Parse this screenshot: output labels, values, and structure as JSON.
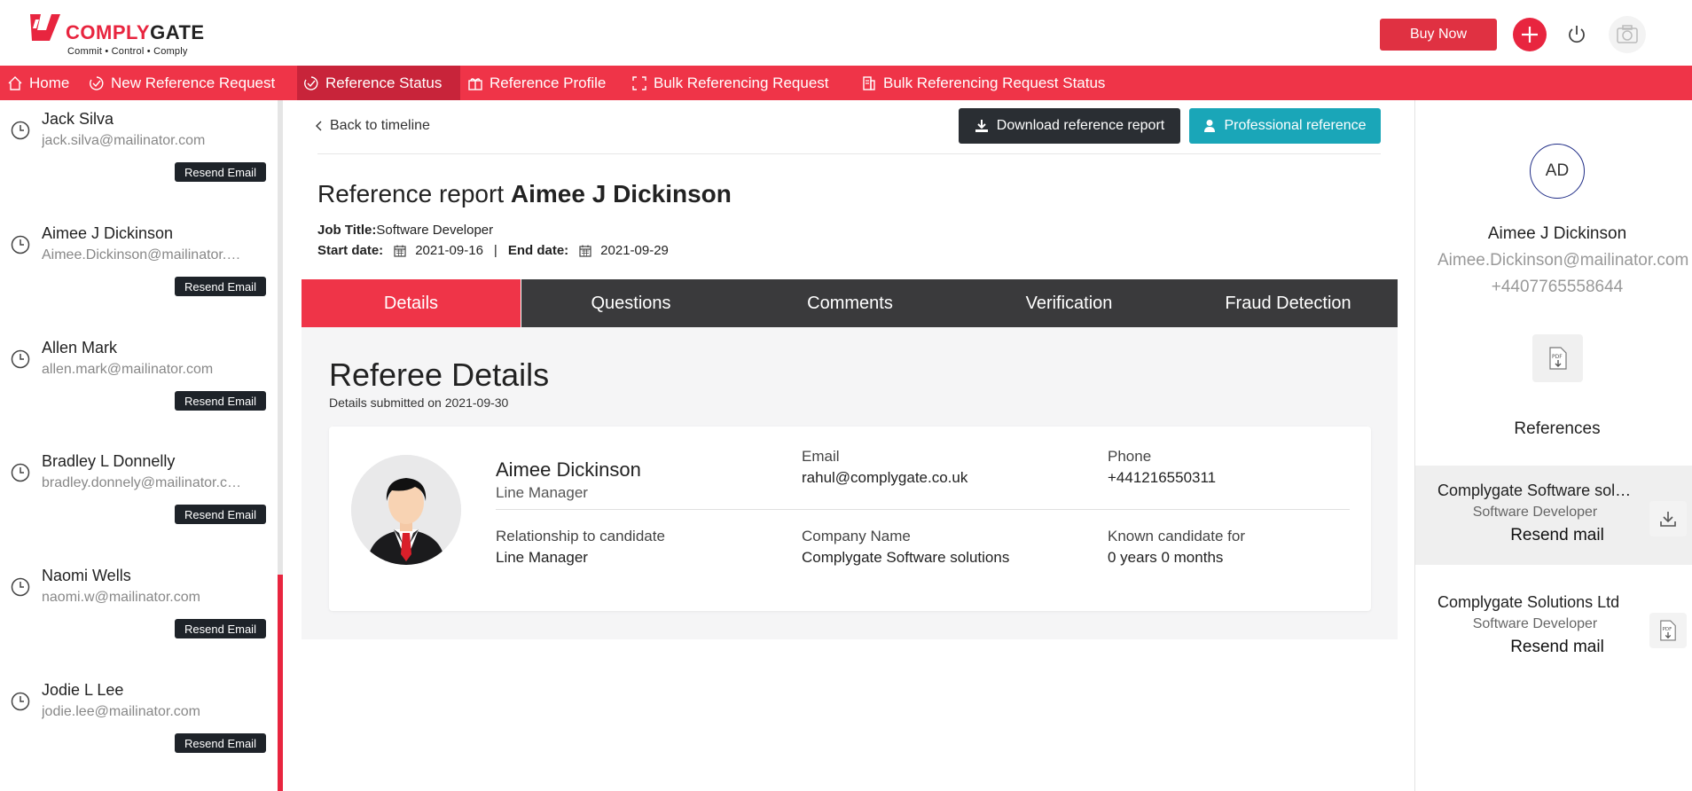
{
  "brand": {
    "name_red": "COMPLY",
    "name_dark": "GATE",
    "tagline": "Commit • Control • Comply",
    "accent_color": "#ef3448"
  },
  "header": {
    "buy_now_label": "Buy Now"
  },
  "nav": {
    "items": [
      {
        "label": "Home",
        "icon": "home-icon"
      },
      {
        "label": "New Reference Request",
        "icon": "request-icon"
      },
      {
        "label": "Reference Status",
        "icon": "status-icon",
        "active": true
      },
      {
        "label": "Reference Profile",
        "icon": "profile-icon"
      },
      {
        "label": "Bulk Referencing Request",
        "icon": "bulk-icon"
      },
      {
        "label": "Bulk Referencing Request Status",
        "icon": "bulk-status-icon"
      }
    ]
  },
  "candidates": [
    {
      "name": "Jack Silva",
      "email": "jack.silva@mailinator.com",
      "resend": "Resend Email"
    },
    {
      "name": "Aimee J Dickinson",
      "email": "Aimee.Dickinson@mailinator.com",
      "resend": "Resend Email"
    },
    {
      "name": "Allen Mark",
      "email": "allen.mark@mailinator.com",
      "resend": "Resend Email"
    },
    {
      "name": "Bradley L Donnelly",
      "email": "bradley.donnely@mailinator.com",
      "resend": "Resend Email"
    },
    {
      "name": "Naomi Wells",
      "email": "naomi.w@mailinator.com",
      "resend": "Resend Email"
    },
    {
      "name": "Jodie L Lee",
      "email": "jodie.lee@mailinator.com",
      "resend": "Resend Email"
    }
  ],
  "main": {
    "back_label": "Back to timeline",
    "download_label": "Download reference report",
    "professional_label": "Professional reference",
    "title_prefix": "Reference report",
    "title_name": "Aimee J Dickinson",
    "job_title_label": "Job Title:",
    "job_title": "Software Developer",
    "start_label": "Start date:",
    "start_date": "2021-09-16",
    "separator": "|",
    "end_label": "End date:",
    "end_date": "2021-09-29",
    "tabs": [
      "Details",
      "Questions",
      "Comments",
      "Verification",
      "Fraud Detection"
    ],
    "active_tab": "Details"
  },
  "referee": {
    "heading": "Referee Details",
    "submitted": "Details submitted on 2021-09-30",
    "name": "Aimee Dickinson",
    "role": "Line Manager",
    "email_label": "Email",
    "email": "rahul@complygate.co.uk",
    "phone_label": "Phone",
    "phone": "+441216550311",
    "relationship_label": "Relationship to candidate",
    "relationship": "Line Manager",
    "company_label": "Company Name",
    "company": "Complygate Software solutions",
    "known_label": "Known candidate for",
    "known": "0 years 0 months"
  },
  "profile": {
    "initials": "AD",
    "name": "Aimee J Dickinson",
    "email": "Aimee.Dickinson@mailinator.com",
    "phone": "+4407765558644",
    "references_title": "References",
    "references": [
      {
        "company": "Complygate Software solutions",
        "role": "Software Developer",
        "action": "Resend mail",
        "icon": "download-icon"
      },
      {
        "company": "Complygate Solutions Ltd",
        "role": "Software Developer",
        "action": "Resend mail",
        "icon": "pdf-icon"
      }
    ]
  }
}
